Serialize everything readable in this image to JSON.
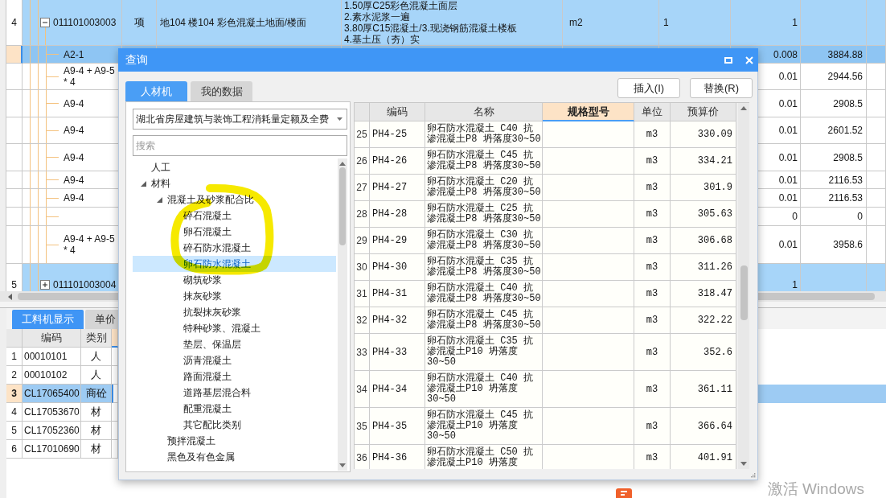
{
  "main_table": {
    "rows": [
      {
        "kind": "item",
        "number": "4",
        "code": "011101003003",
        "expanded": true,
        "selected": false,
        "type": "项",
        "name": "地104 楼104 彩色混凝土地面/楼面",
        "description": [
          "1.50厚C25彩色混凝土面层",
          "2.素水泥浆一遍",
          "3.80厚C15混凝土/3.现浇钢筋混凝土楼板",
          "4.基土压（夯）实"
        ],
        "unit": "m2",
        "expression": "1",
        "quantity": "1"
      },
      {
        "kind": "sub",
        "code": "A2-1",
        "selected": true,
        "quantity": "0.008",
        "price": "3884.88"
      },
      {
        "kind": "sub",
        "code": "A9-4 + A9-5 * 4",
        "selected": false,
        "quantity": "0.01",
        "price": "2944.56"
      },
      {
        "kind": "sub",
        "code": "A9-4",
        "selected": false,
        "quantity": "0.01",
        "price": "2908.5"
      },
      {
        "kind": "sub",
        "code": "A9-4",
        "selected": false,
        "quantity": "0.01",
        "price": "2601.52"
      },
      {
        "kind": "sub",
        "code": "A9-4",
        "selected": false,
        "quantity": "0.01",
        "price": "2908.5"
      },
      {
        "kind": "sub",
        "code": "A9-4",
        "selected": false,
        "quantity": "0.01",
        "price": "2116.53"
      },
      {
        "kind": "sub",
        "code": "A9-4",
        "selected": false,
        "quantity": "0.01",
        "price": "2116.53"
      },
      {
        "kind": "sub",
        "selected": false,
        "quantity": "0",
        "price": "0"
      },
      {
        "kind": "sub",
        "code": "A9-4 + A9-5 * 4",
        "selected": false,
        "quantity": "0.01",
        "price": "3958.6"
      },
      {
        "kind": "item",
        "number": "5",
        "code": "011101003004",
        "expanded": false,
        "selected": false,
        "quantity": "1"
      }
    ]
  },
  "bottom_panel": {
    "tabs": [
      {
        "label": "工料机显示",
        "selected": true
      },
      {
        "label": "单价",
        "selected": false
      }
    ],
    "columns": [
      {
        "label": "编码",
        "selected": false
      },
      {
        "label": "类别",
        "selected": false
      },
      {
        "selected": true
      }
    ],
    "rows": [
      {
        "number": "1",
        "code": "00010101",
        "category": "人",
        "selected": false
      },
      {
        "number": "2",
        "code": "00010102",
        "category": "人",
        "selected": false
      },
      {
        "number": "3",
        "code": "CL17065400",
        "category": "商砼",
        "selected": true
      },
      {
        "number": "4",
        "code": "CL17053670",
        "category": "材",
        "selected": false
      },
      {
        "number": "5",
        "code": "CL17052360",
        "category": "材",
        "selected": false
      },
      {
        "number": "6",
        "code": "CL17010690",
        "category": "材",
        "selected": false
      }
    ]
  },
  "dialog": {
    "title": "查询",
    "tabs": [
      {
        "label": "人材机",
        "selected": true
      },
      {
        "label": "我的数据",
        "selected": false
      }
    ],
    "library": {
      "value": "湖北省房屋建筑与装饰工程消耗量定额及全费"
    },
    "search": {
      "placeholder": "搜索"
    },
    "tree": [
      {
        "label": "人工",
        "selected": false
      },
      {
        "label": "材料",
        "expanded": true,
        "selected": false,
        "children": [
          {
            "label": "混凝土及砂浆配合比",
            "expanded": true,
            "selected": false,
            "children": [
              {
                "label": "碎石混凝土",
                "selected": false
              },
              {
                "label": "卵石混凝土",
                "selected": false
              },
              {
                "label": "碎石防水混凝土",
                "selected": false
              },
              {
                "label": "卵石防水混凝土",
                "selected": true
              },
              {
                "label": "砌筑砂浆",
                "selected": false
              },
              {
                "label": "抹灰砂浆",
                "selected": false
              },
              {
                "label": "抗裂抹灰砂浆",
                "selected": false
              },
              {
                "label": "特种砂浆、混凝土",
                "selected": false
              },
              {
                "label": "垫层、保温层",
                "selected": false
              },
              {
                "label": "沥青混凝土",
                "selected": false
              },
              {
                "label": "路面混凝土",
                "selected": false
              },
              {
                "label": "道路基层混合料",
                "selected": false
              },
              {
                "label": "配重混凝土",
                "selected": false
              },
              {
                "label": "其它配比类别",
                "selected": false
              }
            ]
          },
          {
            "label": "预拌混凝土",
            "selected": false
          },
          {
            "label": "黑色及有色金属",
            "selected": false
          }
        ]
      }
    ],
    "buttons": [
      {
        "label": "插入(I)"
      },
      {
        "label": "替换(R)"
      }
    ],
    "table": {
      "columns": [
        {
          "label": "编码",
          "selected": false
        },
        {
          "label": "名称",
          "selected": false
        },
        {
          "label": "规格型号",
          "selected": true
        },
        {
          "label": "单位",
          "selected": false
        },
        {
          "label": "预算价",
          "selected": false
        }
      ],
      "rows": [
        {
          "number": "25",
          "code": "PH4-25",
          "name": "卵石防水混凝土 C40 抗渗混凝土P8 坍落度30~50",
          "unit": "m3",
          "price": "330.09"
        },
        {
          "number": "26",
          "code": "PH4-26",
          "name": "卵石防水混凝土 C45 抗渗混凝土P8 坍落度30~50",
          "unit": "m3",
          "price": "334.21"
        },
        {
          "number": "27",
          "code": "PH4-27",
          "name": "卵石防水混凝土 C20 抗渗混凝土P8 坍落度30~50",
          "unit": "m3",
          "price": "301.9"
        },
        {
          "number": "28",
          "code": "PH4-28",
          "name": "卵石防水混凝土 C25 抗渗混凝土P8 坍落度30~50",
          "unit": "m3",
          "price": "305.63"
        },
        {
          "number": "29",
          "code": "PH4-29",
          "name": "卵石防水混凝土 C30 抗渗混凝土P8 坍落度30~50",
          "unit": "m3",
          "price": "306.68"
        },
        {
          "number": "30",
          "code": "PH4-30",
          "name": "卵石防水混凝土 C35 抗渗混凝土P8 坍落度30~50",
          "unit": "m3",
          "price": "311.26"
        },
        {
          "number": "31",
          "code": "PH4-31",
          "name": "卵石防水混凝土 C40 抗渗混凝土P8 坍落度30~50",
          "unit": "m3",
          "price": "318.47"
        },
        {
          "number": "32",
          "code": "PH4-32",
          "name": "卵石防水混凝土 C45 抗渗混凝土P8 坍落度30~50",
          "unit": "m3",
          "price": "322.22"
        },
        {
          "number": "33",
          "code": "PH4-33",
          "name": "卵石防水混凝土 C35 抗渗混凝土P10 坍落度30~50",
          "unit": "m3",
          "price": "352.6"
        },
        {
          "number": "34",
          "code": "PH4-34",
          "name": "卵石防水混凝土 C40 抗渗混凝土P10 坍落度30~50",
          "unit": "m3",
          "price": "361.11"
        },
        {
          "number": "35",
          "code": "PH4-35",
          "name": "卵石防水混凝土 C45 抗渗混凝土P10 坍落度30~50",
          "unit": "m3",
          "price": "366.64"
        },
        {
          "number": "36",
          "code": "PH4-36",
          "name": "卵石防水混凝土 C50 抗渗混凝土P10 坍落度",
          "unit": "m3",
          "price": "401.91"
        }
      ]
    }
  },
  "watermark": {
    "text": "激活 Windows"
  }
}
